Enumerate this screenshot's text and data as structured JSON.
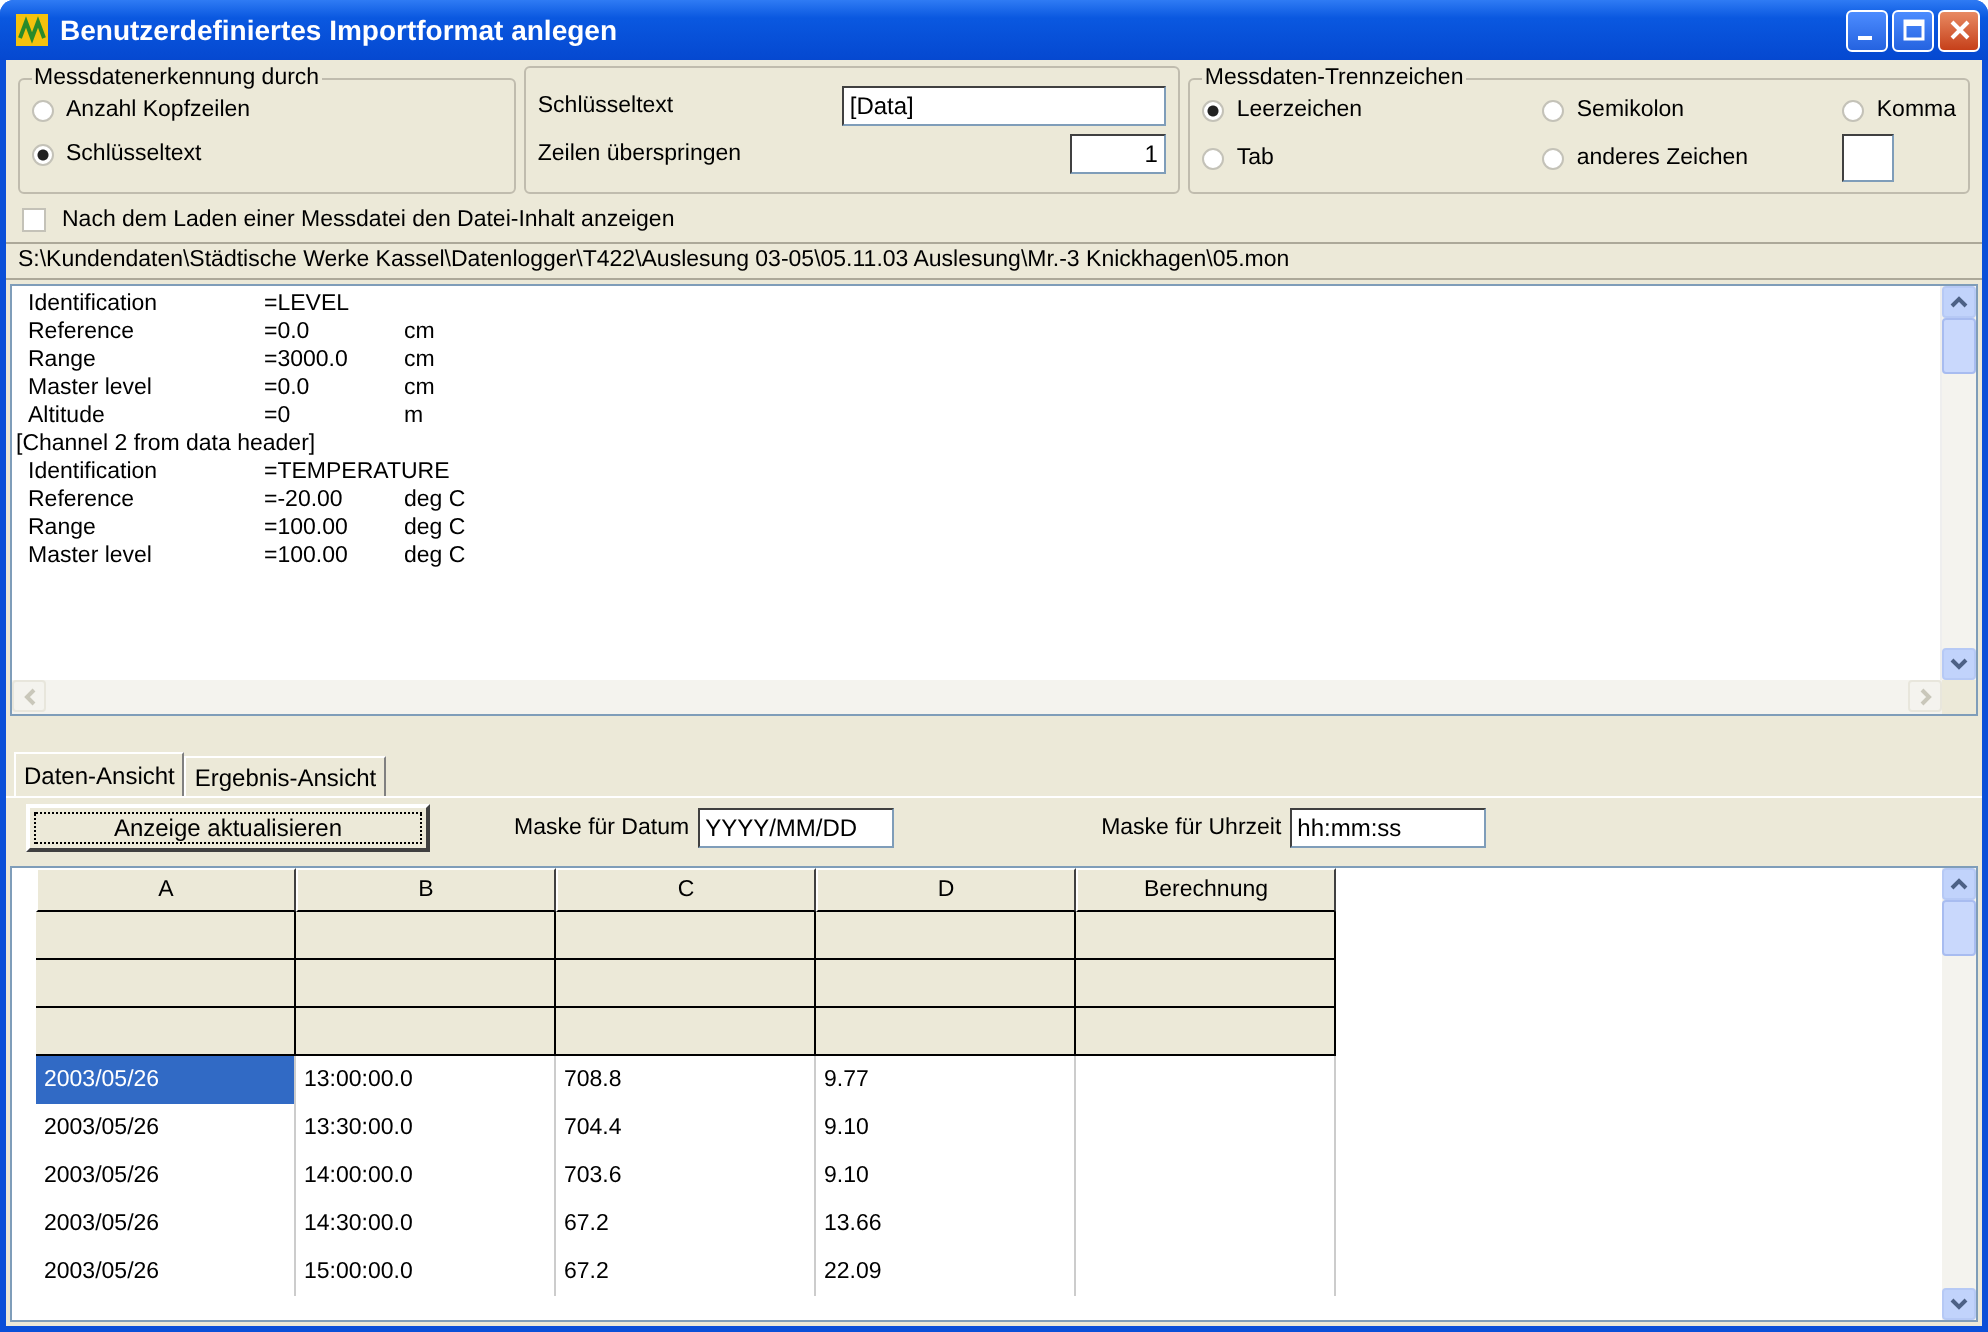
{
  "window": {
    "title": "Benutzerdefiniertes Importformat anlegen"
  },
  "detection": {
    "title": "Messdatenerkennung durch",
    "options": [
      {
        "label": "Anzahl Kopfzeilen",
        "selected": false
      },
      {
        "label": "Schlüsseltext",
        "selected": true
      }
    ]
  },
  "key": {
    "key_label": "Schlüsseltext",
    "key_value": "[Data]",
    "skip_label": "Zeilen überspringen",
    "skip_value": "1"
  },
  "separator": {
    "title": "Messdaten-Trennzeichen",
    "options": [
      {
        "label": "Leerzeichen",
        "selected": true
      },
      {
        "label": "Semikolon",
        "selected": false
      },
      {
        "label": "Komma",
        "selected": false
      },
      {
        "label": "Tab",
        "selected": false
      },
      {
        "label": "anderes Zeichen",
        "selected": false
      }
    ]
  },
  "show_content": {
    "label": "Nach dem Laden einer Messdatei den Datei-Inhalt anzeigen",
    "checked": false
  },
  "file_path": "S:\\Kundendaten\\Städtische Werke Kassel\\Datenlogger\\T422\\Auslesung 03-05\\05.11.03 Auslesung\\Mr.-3 Knickhagen\\05.mon",
  "file_lines": [
    {
      "kind": "entry",
      "label": "Identification",
      "value": "=LEVEL"
    },
    {
      "kind": "entry",
      "label": "Reference",
      "value": "=0.0",
      "unit": "cm"
    },
    {
      "kind": "entry",
      "label": "Range",
      "value": "=3000.0",
      "unit": "cm"
    },
    {
      "kind": "entry",
      "label": "Master level",
      "value": "=0.0",
      "unit": "cm"
    },
    {
      "kind": "entry",
      "label": "Altitude",
      "value": "=0",
      "unit": "m"
    },
    {
      "kind": "header",
      "text": "[Channel 2 from data header]"
    },
    {
      "kind": "entry",
      "label": "Identification",
      "value": "=TEMPERATURE"
    },
    {
      "kind": "entry",
      "label": "Reference",
      "value": "=-20.00",
      "unit": "deg C"
    },
    {
      "kind": "entry",
      "label": "Range",
      "value": "=100.00",
      "unit": "deg C"
    },
    {
      "kind": "entry",
      "label": "Master level",
      "value": "=100.00",
      "unit": "deg C"
    }
  ],
  "tabs": [
    {
      "label": "Daten-Ansicht",
      "selected": true
    },
    {
      "label": "Ergebnis-Ansicht",
      "selected": false
    }
  ],
  "toolbar": {
    "refresh_button": "Anzeige aktualisieren",
    "date_mask_label": "Maske für Datum",
    "date_mask": "YYYY/MM/DD",
    "time_mask_label": "Maske für Uhrzeit",
    "time_mask": "hh:mm:ss"
  },
  "table": {
    "columns": [
      "A",
      "B",
      "C",
      "D",
      "Berechnung"
    ],
    "rows": [
      {
        "cells": [
          {
            "text": "2003/05/26",
            "selected": true
          },
          {
            "text": "13:00:00.0",
            "selected": false
          },
          {
            "text": "708.8",
            "selected": false
          },
          {
            "text": "9.77",
            "selected": false
          }
        ]
      },
      {
        "cells": [
          {
            "text": "2003/05/26",
            "selected": false
          },
          {
            "text": "13:30:00.0",
            "selected": false
          },
          {
            "text": "704.4",
            "selected": false
          },
          {
            "text": "9.10",
            "selected": false
          }
        ]
      },
      {
        "cells": [
          {
            "text": "2003/05/26",
            "selected": false
          },
          {
            "text": "14:00:00.0",
            "selected": false
          },
          {
            "text": "703.6",
            "selected": false
          },
          {
            "text": "9.10",
            "selected": false
          }
        ]
      },
      {
        "cells": [
          {
            "text": "2003/05/26",
            "selected": false
          },
          {
            "text": "14:30:00.0",
            "selected": false
          },
          {
            "text": "67.2",
            "selected": false
          },
          {
            "text": "13.66",
            "selected": false
          }
        ]
      },
      {
        "cells": [
          {
            "text": "2003/05/26",
            "selected": false
          },
          {
            "text": "15:00:00.0",
            "selected": false
          },
          {
            "text": "67.2",
            "selected": false
          },
          {
            "text": "22.09",
            "selected": false
          }
        ]
      }
    ]
  }
}
